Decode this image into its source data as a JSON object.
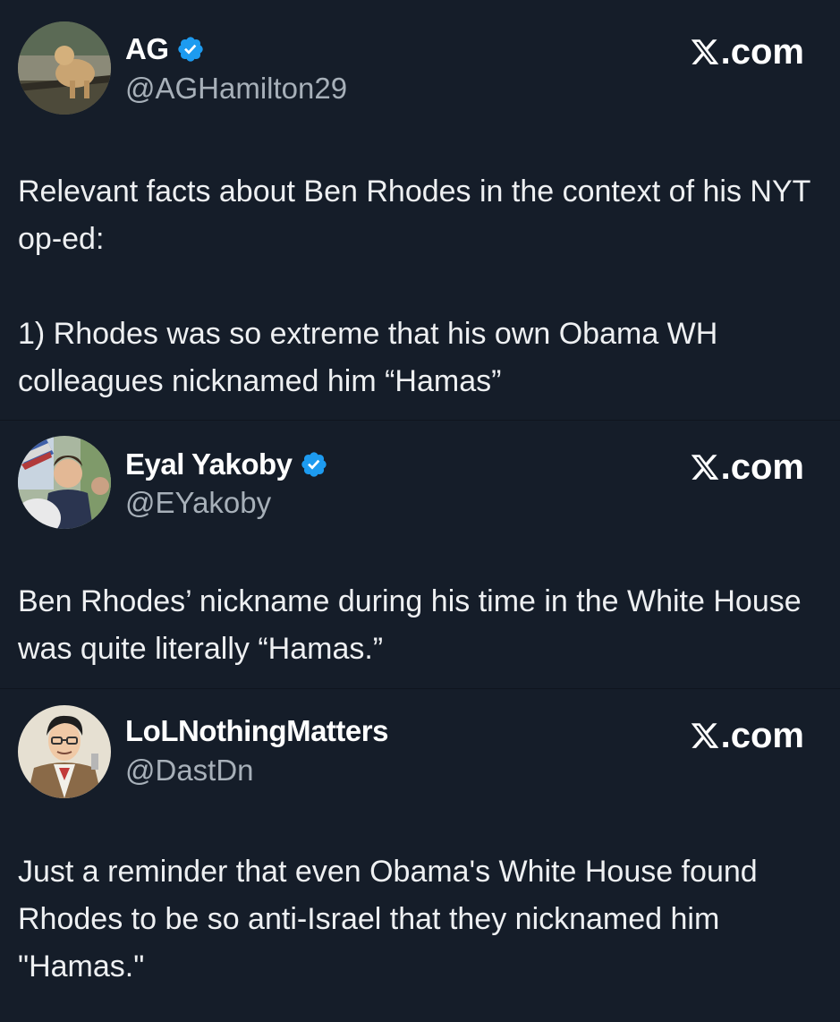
{
  "tweets": [
    {
      "display_name": "AG",
      "verified": true,
      "handle": "@AGHamilton29",
      "brand_text": ".com",
      "brand_icon": "x-logo-icon",
      "text": "Relevant facts about Ben Rhodes in the context of his NYT op-ed:\n\n1) Rhodes was so extreme that his own Obama WH colleagues nicknamed him “Hamas”"
    },
    {
      "display_name": "Eyal Yakoby",
      "verified": true,
      "handle": "@EYakoby",
      "brand_text": ".com",
      "brand_icon": "x-logo-icon",
      "text": "Ben Rhodes’ nickname during his time in the White House was quite literally “Hamas.”"
    },
    {
      "display_name": "LoLNothingMatters",
      "verified": false,
      "handle": "@DastDn",
      "brand_text": ".com",
      "brand_icon": "x-logo-icon",
      "text": "Just a reminder that even Obama's White House found Rhodes to be so anti-Israel that they nicknamed him \"Hamas.\""
    }
  ],
  "colors": {
    "background": "#151d29",
    "text": "#e7e9ea",
    "handle": "#a7b0b9",
    "verified": "#1d9bf0"
  }
}
